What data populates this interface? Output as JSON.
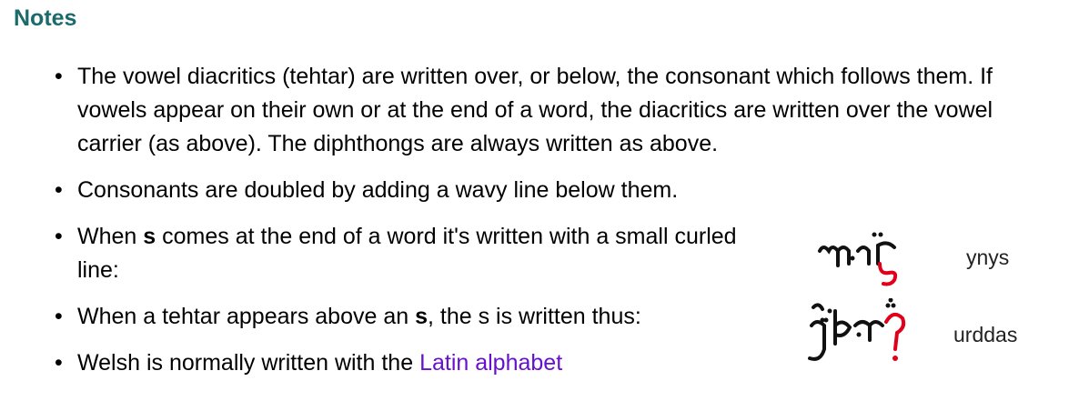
{
  "heading": "Notes",
  "notes": {
    "item1": "The vowel diacritics (tehtar) are written over, or below, the consonant which follows them. If vowels appear on their own or at the end of a word, the diacritics are written over the vowel carrier (as above). The diphthongs are always written as above.",
    "item2": "Consonants are doubled by adding a wavy line below them.",
    "item3_before": "When ",
    "item3_bold": "s",
    "item3_after": " comes at the end of a word it's written with a small curled line:",
    "item4_before": "When a tehtar appears above an ",
    "item4_bold": "s",
    "item4_after": ", the s is written thus:",
    "item5_before": "Welsh is normally written with the ",
    "item5_link": "Latin alphabet"
  },
  "examples": [
    {
      "label": "ynys"
    },
    {
      "label": "urddas"
    }
  ],
  "colors": {
    "heading": "#1b6b6b",
    "link": "#6611cc",
    "accent_glyph": "#e0001b"
  }
}
